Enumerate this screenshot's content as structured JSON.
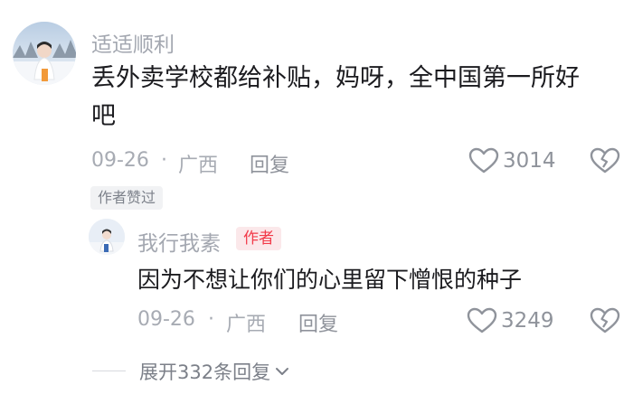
{
  "comment": {
    "username": "适适顺利",
    "text_line1": "丢外卖学校都给补贴，妈呀，全中国第一所好",
    "text_line2": "吧",
    "date": "09-26",
    "separator": "·",
    "location": "广西",
    "reply_label": "回复",
    "likes": "3014",
    "author_liked_badge": "作者赞过"
  },
  "reply": {
    "username": "我行我素",
    "author_badge": "作者",
    "text": "因为不想让你们的心里留下憎恨的种子",
    "date": "09-26",
    "separator": "·",
    "location": "广西",
    "reply_label": "回复",
    "likes": "3249"
  },
  "expand": {
    "label": "展开332条回复"
  },
  "icons": {
    "like": "heart-outline-icon",
    "dislike": "broken-heart-icon",
    "expand": "chevron-down-icon"
  },
  "colors": {
    "author_badge_text": "#f23b4a",
    "author_badge_bg": "#fbe8ea"
  }
}
